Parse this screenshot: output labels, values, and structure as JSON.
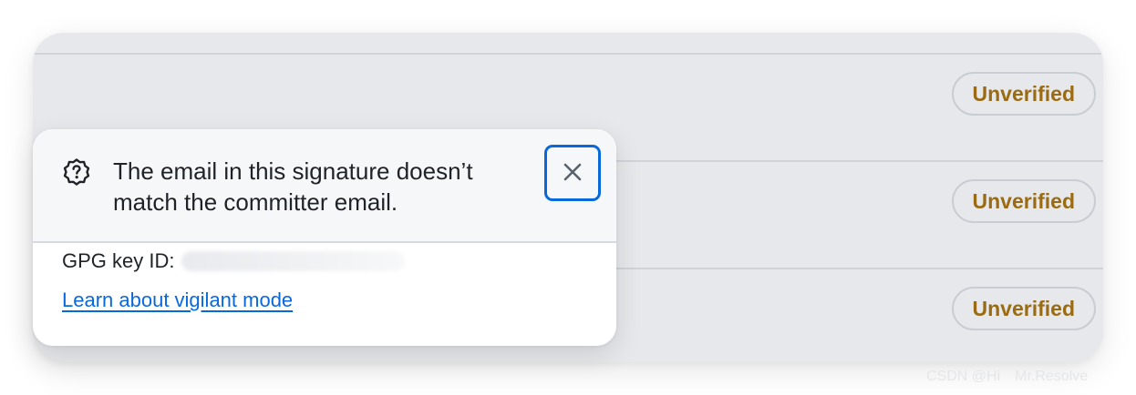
{
  "commit_list": {
    "rows": [
      {
        "badge": "Unverified"
      },
      {
        "badge": "Unverified"
      },
      {
        "badge": "Unverified"
      }
    ]
  },
  "popover": {
    "icon": "question-badge-icon",
    "message_line1": "The email in this signature doesn’t",
    "message_line2": "match the committer email.",
    "close_icon": "close-icon",
    "key_label": "GPG key ID:",
    "learn_link": "Learn about vigilant mode"
  },
  "watermark": "CSDN @Hi　Mr.Resolve",
  "colors": {
    "badge_text": "#9a6b12",
    "link": "#0969da",
    "focus_ring": "#0a69da",
    "list_background": "#e6e8eb"
  }
}
